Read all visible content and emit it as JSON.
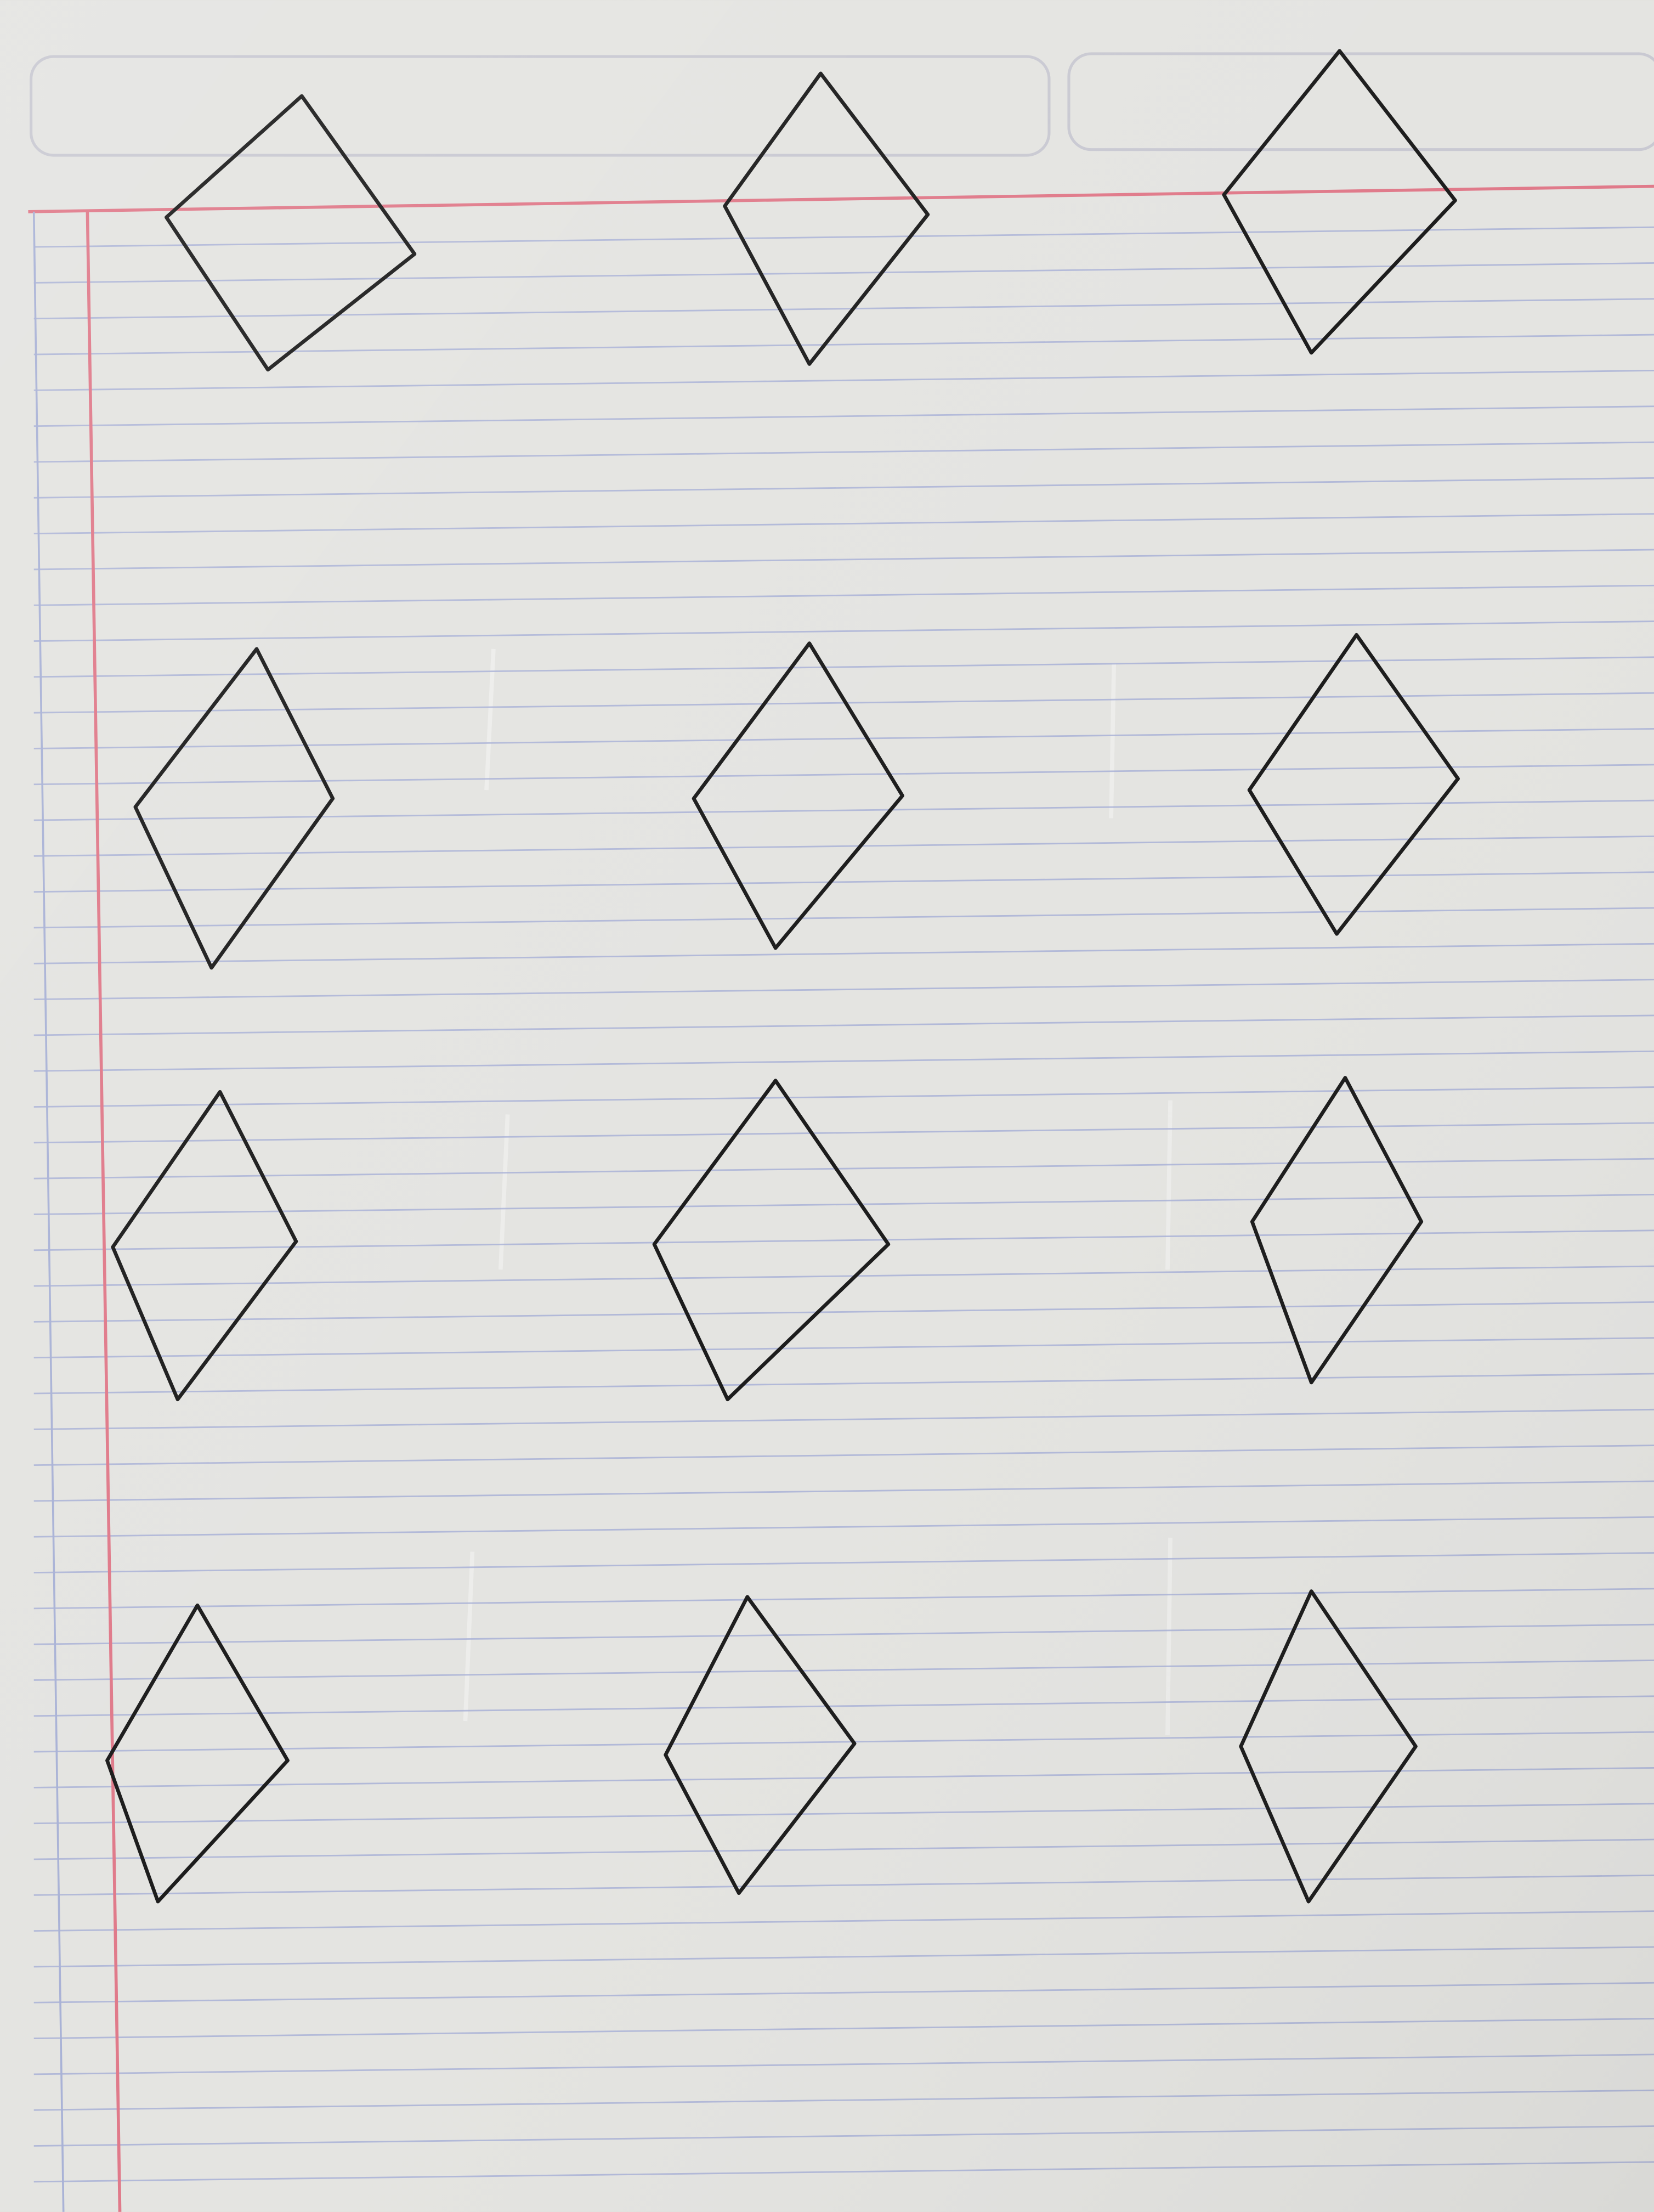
{
  "paper": {
    "background_color": "#e4e4e1",
    "ruled_line_color": "#a9b2d6",
    "margin_line_color": "#e07a8a",
    "header_box_color": "#c9c9d2",
    "ink_color": "#1c1c1c"
  },
  "shapes": {
    "kind": "hand-drawn rhombus",
    "rows": 4,
    "columns": 3,
    "count": 12
  }
}
